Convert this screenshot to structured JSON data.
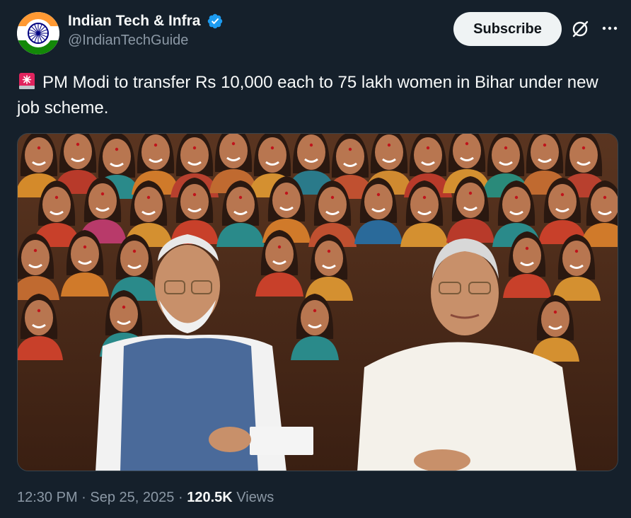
{
  "author": {
    "display_name": "Indian Tech & Infra",
    "handle": "@IndianTechGuide",
    "verified": true,
    "avatar_icon": "india-flag-avatar"
  },
  "actions": {
    "subscribe_label": "Subscribe",
    "grok_icon": "grok-icon",
    "more_icon": "more-icon"
  },
  "tweet": {
    "emoji": "siren-icon",
    "text": "PM Modi to transfer Rs 10,000 each to 75 lakh women in Bihar under new job scheme."
  },
  "meta": {
    "time": "12:30 PM",
    "separator1": "·",
    "date": "Sep 25, 2025",
    "separator2": "·",
    "views_count": "120.5K",
    "views_label": "Views"
  },
  "colors": {
    "background": "#15202b",
    "text_primary": "#f7f9f9",
    "text_secondary": "#8b98a5",
    "verified_blue": "#1d9bf0",
    "button_bg": "#eff3f4"
  }
}
